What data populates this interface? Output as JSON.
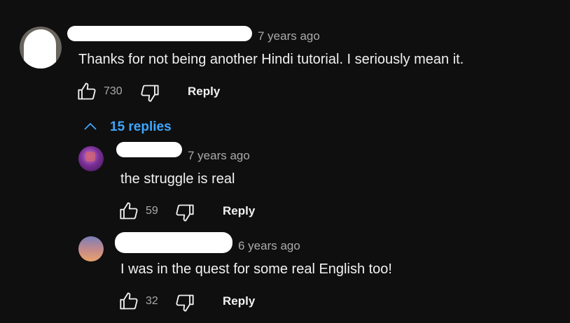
{
  "comment": {
    "time": "7 years ago",
    "text": "Thanks for not being another Hindi tutorial. I seriously mean it.",
    "likes": "730",
    "reply_label": "Reply"
  },
  "replies_toggle": {
    "label": "15 replies"
  },
  "replies": [
    {
      "time": "7 years ago",
      "text": "the struggle is real",
      "likes": "59",
      "reply_label": "Reply"
    },
    {
      "time": "6 years ago",
      "text": "I was in the quest for some real English too!",
      "likes": "32",
      "reply_label": "Reply"
    }
  ],
  "colors": {
    "background": "#0f0f0f",
    "text": "#f1f1f1",
    "meta": "#aaaaaa",
    "link": "#3ea6ff"
  }
}
